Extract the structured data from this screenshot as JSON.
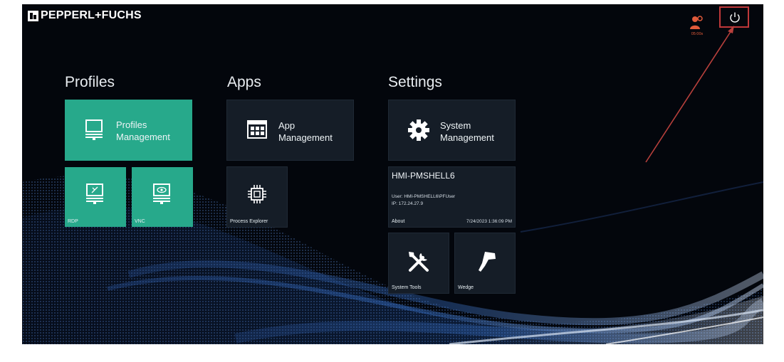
{
  "brand": {
    "name": "PEPPERL+FUCHS"
  },
  "header": {
    "timer": "05:00s",
    "timer_icon": "user-timer-icon",
    "power_icon": "power-icon"
  },
  "sections": {
    "profiles": "Profiles",
    "apps": "Apps",
    "settings": "Settings"
  },
  "tiles": {
    "profiles_management": {
      "line1": "Profiles",
      "line2": "Management",
      "icon": "computer-icon"
    },
    "rdp": {
      "label": "RDP",
      "icon": "rdp-icon"
    },
    "vnc": {
      "label": "VNC",
      "icon": "vnc-icon"
    },
    "app_management": {
      "line1": "App",
      "line2": "Management",
      "icon": "app-grid-icon"
    },
    "process_explorer": {
      "label": "Process Explorer",
      "icon": "chip-icon"
    },
    "system_management": {
      "line1": "System",
      "line2": "Management",
      "icon": "gear-icon"
    },
    "system_tools": {
      "label": "System Tools",
      "icon": "tools-icon"
    },
    "wedge": {
      "label": "Wedge",
      "icon": "scanner-icon"
    }
  },
  "device_info": {
    "hostname": "HMI-PMSHELL6",
    "user": "User: HMI-PMSHELL6\\PFUser",
    "ip": "IP: 172.24.27.9",
    "about": "About",
    "datetime": "7/24/2023 1:36:09 PM"
  },
  "colors": {
    "tile_green": "#27a98b",
    "tile_dark": "#151d27",
    "background": "#03060c",
    "highlight_red": "#c0383a",
    "timer_orange": "#e05a3a"
  }
}
